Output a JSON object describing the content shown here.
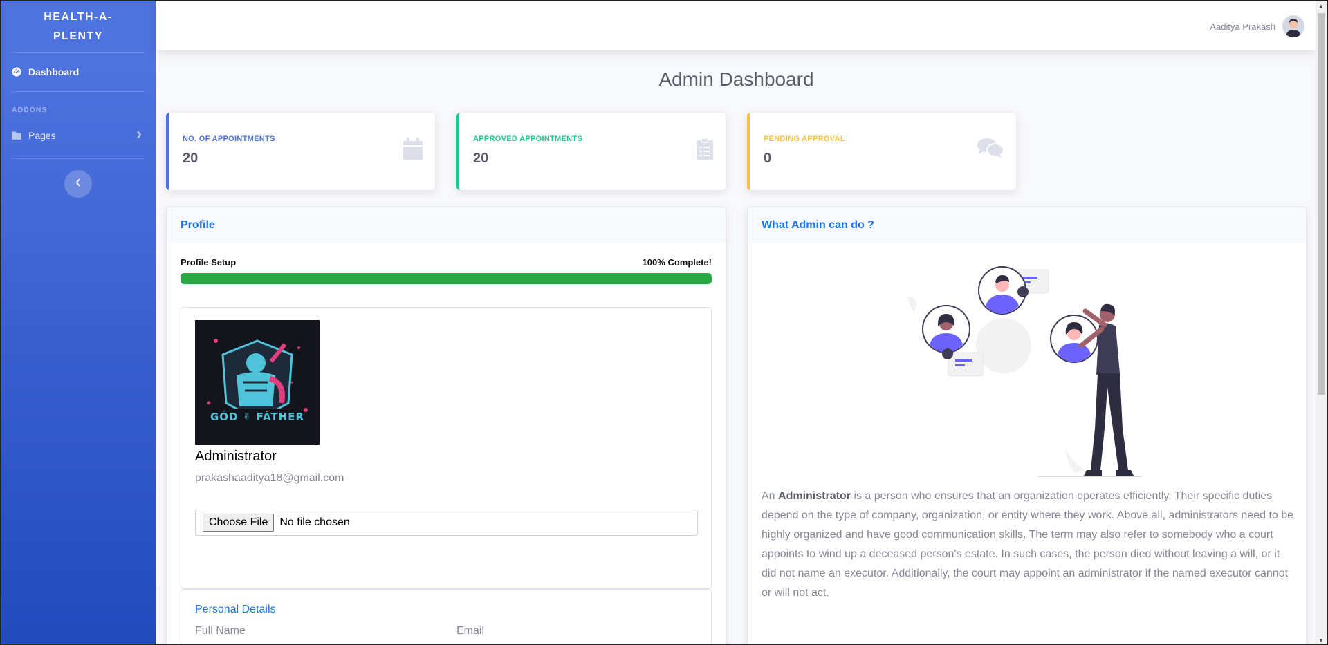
{
  "brand": {
    "line1": "HEALTH-A-",
    "line2": "PLENTY"
  },
  "sidebar": {
    "dashboard_label": "Dashboard",
    "addons_heading": "ADDONS",
    "pages_label": "Pages"
  },
  "topbar": {
    "user_name": "Aaditya Prakash"
  },
  "page_title": "Admin Dashboard",
  "stats": [
    {
      "label": "NO. OF APPOINTMENTS",
      "value": "20",
      "color": "#4e73df",
      "icon": "calendar-icon"
    },
    {
      "label": "APPROVED APPOINTMENTS",
      "value": "20",
      "color": "#1cc88a",
      "icon": "clipboard-list-icon"
    },
    {
      "label": "PENDING APPROVAL",
      "value": "0",
      "color": "#f6c23e",
      "icon": "comments-icon"
    }
  ],
  "profile": {
    "header": "Profile",
    "setup_label": "Profile Setup",
    "complete_label": "100% Complete!",
    "progress": 1.0,
    "role": "Administrator",
    "email": "prakashaaditya18@gmail.com",
    "file_button": "Choose File",
    "file_status": "No file chosen",
    "avatar_text": "GÓD ✌ FÁTHER",
    "personal_details_heading": "Personal Details",
    "full_name_label": "Full Name",
    "email_label": "Email"
  },
  "admin_info": {
    "header": "What Admin can do ?",
    "desc_before": "An ",
    "desc_bold": "Administrator",
    "desc_after": " is a person who ensures that an organization operates efficiently. Their specific duties depend on the type of company, organization, or entity where they work. Above all, administrators need to be highly organized and have good communication skills. The term may also refer to somebody who a court appoints to wind up a deceased person's estate. In such cases, the person died without leaving a will, or it did not name an executor. Additionally, the court may appoint an administrator if the named executor cannot or will not act."
  },
  "colors": {
    "sidebar_top": "#4e73df",
    "sidebar_bottom": "#224abe",
    "link_blue": "#1a73e8",
    "progress_green": "#28a745",
    "illustration_purple": "#6c63ff"
  }
}
